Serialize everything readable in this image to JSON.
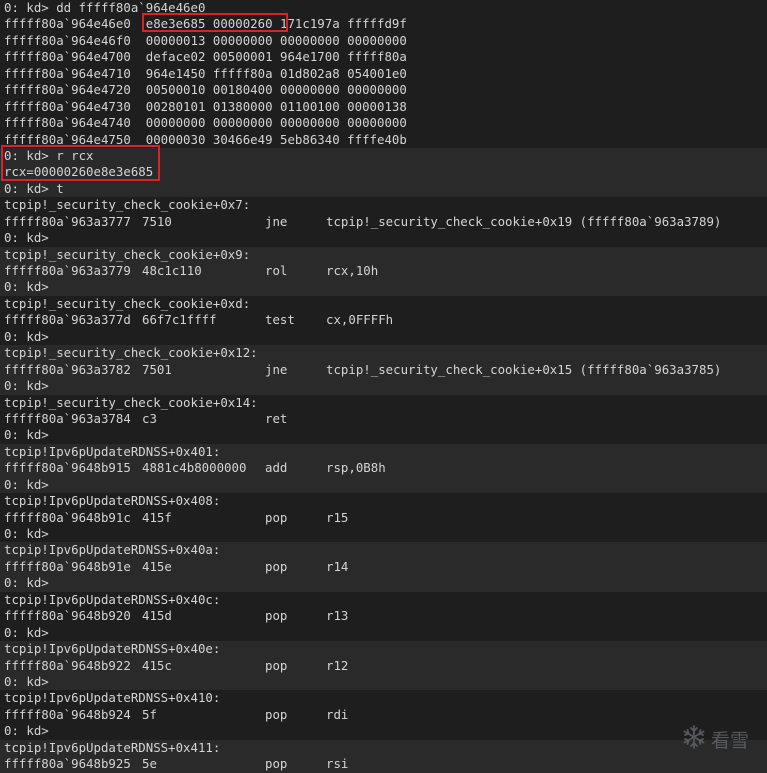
{
  "console": {
    "dump_lines": [
      "0: kd> dd fffff80a`964e46e0",
      "fffff80a`964e46e0  e8e3e685 00000260 171c197a fffffd9f",
      "fffff80a`964e46f0  00000013 00000000 00000000 00000000",
      "fffff80a`964e4700  deface02 00500001 964e1700 fffff80a",
      "fffff80a`964e4710  964e1450 fffff80a 01d802a8 054001e0",
      "fffff80a`964e4720  00500010 00180400 00000000 00000000",
      "fffff80a`964e4730  00280101 01380000 01100100 00000138",
      "fffff80a`964e4740  00000000 00000000 00000000 00000000",
      "fffff80a`964e4750  00000030 30466e49 5eb86340 ffffe40b"
    ],
    "register_lines": [
      "0: kd> r rcx",
      "rcx=00000260e8e3e685",
      "0: kd> t"
    ],
    "trace": [
      {
        "symbol": "tcpip!_security_check_cookie+0x7:",
        "addr": "fffff80a`963a3777",
        "bytes": "7510",
        "mnemonic": "jne",
        "operands": "tcpip!_security_check_cookie+0x19 (fffff80a`963a3789)",
        "prompt": "0: kd>"
      },
      {
        "symbol": "tcpip!_security_check_cookie+0x9:",
        "addr": "fffff80a`963a3779",
        "bytes": "48c1c110",
        "mnemonic": "rol",
        "operands": "rcx,10h",
        "prompt": "0: kd>"
      },
      {
        "symbol": "tcpip!_security_check_cookie+0xd:",
        "addr": "fffff80a`963a377d",
        "bytes": "66f7c1ffff",
        "mnemonic": "test",
        "operands": "cx,0FFFFh",
        "prompt": "0: kd>"
      },
      {
        "symbol": "tcpip!_security_check_cookie+0x12:",
        "addr": "fffff80a`963a3782",
        "bytes": "7501",
        "mnemonic": "jne",
        "operands": "tcpip!_security_check_cookie+0x15 (fffff80a`963a3785)",
        "prompt": "0: kd>"
      },
      {
        "symbol": "tcpip!_security_check_cookie+0x14:",
        "addr": "fffff80a`963a3784",
        "bytes": "c3",
        "mnemonic": "ret",
        "operands": "",
        "prompt": "0: kd>"
      },
      {
        "symbol": "tcpip!Ipv6pUpdateRDNSS+0x401:",
        "addr": "fffff80a`9648b915",
        "bytes": "4881c4b8000000",
        "mnemonic": "add",
        "operands": "rsp,0B8h",
        "prompt": "0: kd>"
      },
      {
        "symbol": "tcpip!Ipv6pUpdateRDNSS+0x408:",
        "addr": "fffff80a`9648b91c",
        "bytes": "415f",
        "mnemonic": "pop",
        "operands": "r15",
        "prompt": "0: kd>"
      },
      {
        "symbol": "tcpip!Ipv6pUpdateRDNSS+0x40a:",
        "addr": "fffff80a`9648b91e",
        "bytes": "415e",
        "mnemonic": "pop",
        "operands": "r14",
        "prompt": "0: kd>"
      },
      {
        "symbol": "tcpip!Ipv6pUpdateRDNSS+0x40c:",
        "addr": "fffff80a`9648b920",
        "bytes": "415d",
        "mnemonic": "pop",
        "operands": "r13",
        "prompt": "0: kd>"
      },
      {
        "symbol": "tcpip!Ipv6pUpdateRDNSS+0x40e:",
        "addr": "fffff80a`9648b922",
        "bytes": "415c",
        "mnemonic": "pop",
        "operands": "r12",
        "prompt": "0: kd>"
      },
      {
        "symbol": "tcpip!Ipv6pUpdateRDNSS+0x410:",
        "addr": "fffff80a`9648b924",
        "bytes": "5f",
        "mnemonic": "pop",
        "operands": "rdi",
        "prompt": "0: kd>"
      },
      {
        "symbol": "tcpip!Ipv6pUpdateRDNSS+0x411:",
        "addr": "fffff80a`9648b925",
        "bytes": "5e",
        "mnemonic": "pop",
        "operands": "rsi",
        "prompt": ""
      }
    ]
  },
  "watermark": {
    "text": "看雪",
    "icon": "snowflake-icon"
  },
  "colors": {
    "background": "#1e1e1e",
    "alt_row": "#2a2a2a",
    "text": "#d4d4d4",
    "highlight_box": "#d9232b"
  }
}
